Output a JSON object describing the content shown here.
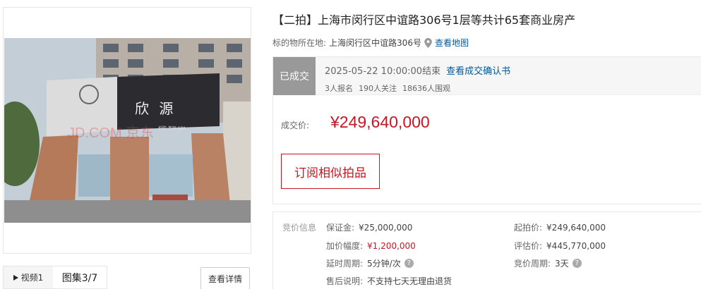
{
  "gallery": {
    "watermark": "JD.COM 京东",
    "sign_text": "欣 源",
    "sign_sub": "护肤 美容 SPA",
    "tab_video": "视频1",
    "tab_gallery": "图集3/7",
    "detail_button": "查看详情"
  },
  "auction": {
    "title": "【二拍】上海市闵行区中谊路306号1层等共计65套商业房产",
    "location_label": "标的物所在地:",
    "location_address": "上海闵行区中谊路306号",
    "map_link": "查看地图",
    "status_badge": "已成交",
    "end_time": "2025-05-22 10:00:00结束",
    "confirm_link": "查看成交确认书",
    "signups": "3人报名",
    "followers": "190人关注",
    "viewers": "18636人围观",
    "deal_price_label": "成交价:",
    "deal_price": "¥249,640,000",
    "subscribe_button": "订阅相似拍品"
  },
  "bidding": {
    "heading": "竞价信息",
    "deposit_label": "保证金:",
    "deposit_value": "¥25,000,000",
    "starting_price_label": "起拍价:",
    "starting_price_value": "¥249,640,000",
    "increment_label": "加价幅度:",
    "increment_value": "¥1,200,000",
    "valuation_label": "评估价:",
    "valuation_value": "¥445,770,000",
    "delay_label": "延时周期:",
    "delay_value": "5分钟/次",
    "bid_cycle_label": "竞价周期:",
    "bid_cycle_value": "3天",
    "after_sale_label": "售后说明:",
    "after_sale_value": "不支持七天无理由退货"
  },
  "colors": {
    "accent_red": "#c81623",
    "link_blue": "#005aa0",
    "badge_gray": "#999999"
  }
}
